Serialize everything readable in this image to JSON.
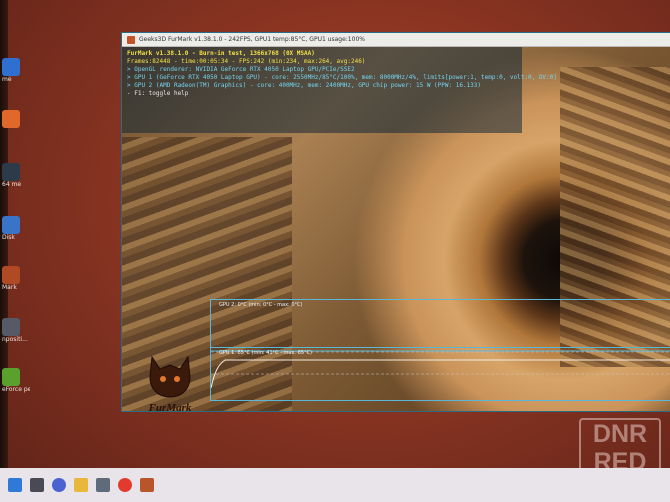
{
  "window": {
    "title": "Geeks3D FurMark v1.38.1.0 - 242FPS, GPU1 temp:85°C, GPU1 usage:100%"
  },
  "hud": {
    "line1": "FurMark v1.38.1.0 - Burn-in test, 1366x768 (0X MSAA)",
    "line2": "Frames:82448 - time:00:05:34 - FPS:242 (min:234, max:264, avg:246)",
    "line3": "> OpenGL renderer: NVIDIA GeForce RTX 4050 Laptop GPU/PCIe/SSE2",
    "line4": "> GPU 1 (GeForce RTX 4050 Laptop GPU) - core: 2550MHz/85°C/100%, mem: 8000MHz/4%, limits[power:1, temp:0, volt:0, OV:0]",
    "line5": "> GPU 2 (AMD Radeon(TM) Graphics) - core: 400MHz, mem: 2400MHz, GPU chip power: 15 W (PPW: 16.133)",
    "line6": "- F1: toggle help"
  },
  "graphs": {
    "gpu2_label": "GPU 2: 0°C (min: 0°C - max: 0°C)",
    "gpu1_label": "GPU 1: 85°C (min: 41°C - max: 85°C)"
  },
  "logo_text": "FurMark",
  "desktop_icons": [
    {
      "label": "me",
      "color": "#2e6fd0"
    },
    {
      "label": "",
      "color": "#e0682a"
    },
    {
      "label": "64 me",
      "color": "#2d3a4a"
    },
    {
      "label": "Disk",
      "color": "#3a74c8"
    },
    {
      "label": "Mark",
      "color": "#b04a24"
    },
    {
      "label": "npositi... chmark",
      "color": "#555a66"
    },
    {
      "label": "eForce perience",
      "color": "#5aa02c"
    }
  ],
  "taskbar_buttons": [
    {
      "name": "start-button",
      "color": "#2f7ad8"
    },
    {
      "name": "task-view-button",
      "color": "#4a4a55"
    },
    {
      "name": "chat-button",
      "color": "#4b63d0"
    },
    {
      "name": "file-explorer-button",
      "color": "#e7b83a"
    },
    {
      "name": "browser-button",
      "color": "#5f6b7a"
    },
    {
      "name": "yandex-button",
      "color": "#e23b2e"
    },
    {
      "name": "furmark-taskbar-button",
      "color": "#b8552a"
    }
  ],
  "watermark": {
    "line1": "DNR",
    "line2": "RED"
  }
}
